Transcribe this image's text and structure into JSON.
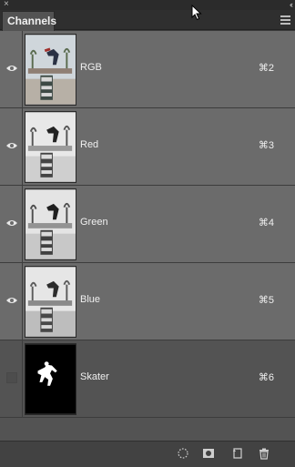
{
  "panel": {
    "close_glyph": "×",
    "collapse_glyph": "‹‹",
    "tab_label": "Channels"
  },
  "channels": [
    {
      "name": "RGB",
      "shortcut": "⌘2",
      "visible": true,
      "selected": true,
      "thumb": "color"
    },
    {
      "name": "Red",
      "shortcut": "⌘3",
      "visible": true,
      "selected": true,
      "thumb": "gray"
    },
    {
      "name": "Green",
      "shortcut": "⌘4",
      "visible": true,
      "selected": true,
      "thumb": "gray"
    },
    {
      "name": "Blue",
      "shortcut": "⌘5",
      "visible": true,
      "selected": true,
      "thumb": "gray"
    },
    {
      "name": "Skater",
      "shortcut": "⌘6",
      "visible": false,
      "selected": false,
      "thumb": "mask"
    }
  ],
  "footer": {
    "icons": [
      "load-selection-icon",
      "save-selection-icon",
      "new-channel-icon",
      "trash-icon"
    ]
  },
  "colors": {
    "panel_bg": "#535353",
    "selected_row": "#6b6b6b",
    "chrome_bg": "#2f2f2f"
  }
}
